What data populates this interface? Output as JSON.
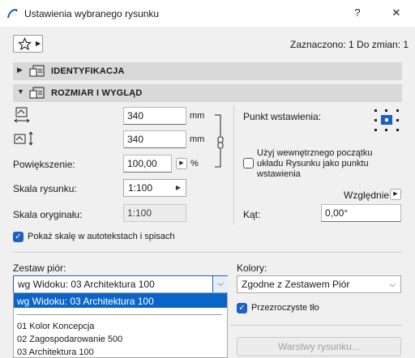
{
  "window": {
    "title": "Ustawienia wybranego rysunku",
    "help_label": "?",
    "close_label": "✕"
  },
  "header": {
    "selection_status": "Zaznaczono: 1 Do zmian: 1"
  },
  "sections": {
    "identification": "IDENTYFIKACJA",
    "size_appearance": "ROZMIAR I WYGLĄD"
  },
  "size": {
    "width_value": "340",
    "width_unit": "mm",
    "height_value": "340",
    "height_unit": "mm",
    "magnification_label": "Powiększenie:",
    "magnification_value": "100,00",
    "magnification_unit": "%",
    "drawing_scale_label": "Skala rysunku:",
    "drawing_scale_value": "1:100",
    "original_scale_label": "Skala oryginału:",
    "original_scale_value": "1:100"
  },
  "anchor": {
    "label": "Punkt wstawienia:",
    "use_internal_origin_label_1": "Użyj wewnętrznego początku",
    "use_internal_origin_label_2": "układu Rysunku jako punktu",
    "use_internal_origin_label_3": "wstawienia",
    "use_internal_origin_checked": false,
    "relative_label": "Względnie",
    "angle_label": "Kąt:",
    "angle_value": "0,00°"
  },
  "show_scale_label": "Pokaż skalę w autotekstach i spisach",
  "show_scale_checked": true,
  "pens": {
    "label": "Zestaw piór:",
    "selected": "wg Widoku: 03 Architektura 100",
    "options": [
      "wg Widoku: 03 Architektura 100",
      "01 Kolor Koncepcja",
      "02 Zagospodarowanie 500",
      "03 Architektura 100"
    ]
  },
  "colors": {
    "label": "Kolory:",
    "selected": "Zgodne z Zestawem Piór",
    "transparent_label": "Przezroczyste tło",
    "transparent_checked": true
  },
  "layers_button": "Warstwy rysunku...",
  "accent_color": "#1f5fbf",
  "selection_color": "#0b64c8"
}
